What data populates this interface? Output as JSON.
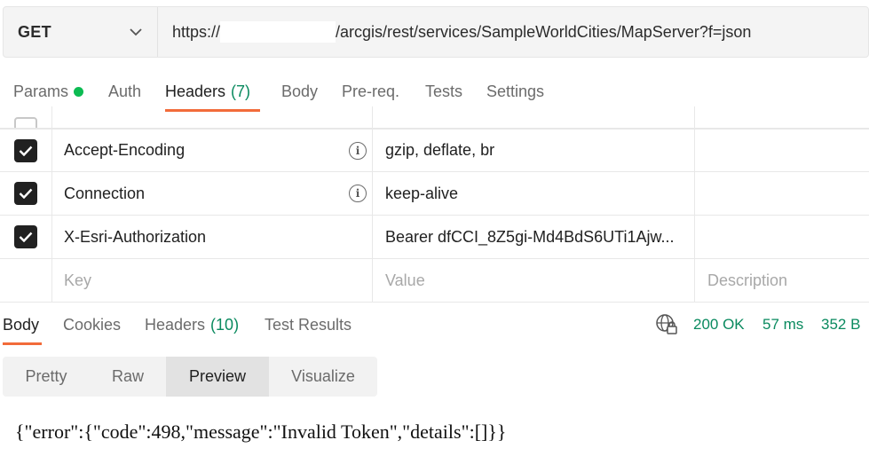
{
  "request": {
    "method": "GET",
    "url_prefix": "https://",
    "url_suffix": "/arcgis/rest/services/SampleWorldCities/MapServer?f=json"
  },
  "request_tabs": [
    {
      "label": "Params",
      "indicator": "green-dot"
    },
    {
      "label": "Auth"
    },
    {
      "label": "Headers",
      "count": "(7)",
      "active": true
    },
    {
      "label": "Body"
    },
    {
      "label": "Pre-req."
    },
    {
      "label": "Tests"
    },
    {
      "label": "Settings"
    }
  ],
  "headers": {
    "rows": [
      {
        "key": "Accept-Encoding",
        "value": "gzip, deflate, br",
        "checked": true,
        "info": true
      },
      {
        "key": "Connection",
        "value": "keep-alive",
        "checked": true,
        "info": true
      },
      {
        "key": "X-Esri-Authorization",
        "value": "Bearer dfCCI_8Z5gi-Md4BdS6UTi1Ajw...",
        "checked": true,
        "info": false
      }
    ],
    "new_row": {
      "key_placeholder": "Key",
      "value_placeholder": "Value",
      "description_placeholder": "Description"
    }
  },
  "response_tabs": [
    {
      "label": "Body",
      "active": true
    },
    {
      "label": "Cookies"
    },
    {
      "label": "Headers",
      "count": "(10)"
    },
    {
      "label": "Test Results"
    }
  ],
  "response_status": {
    "status": "200 OK",
    "time": "57 ms",
    "size": "352 B",
    "color": "#0a8a5f"
  },
  "view_modes": [
    {
      "label": "Pretty"
    },
    {
      "label": "Raw"
    },
    {
      "label": "Preview",
      "active": true
    },
    {
      "label": "Visualize"
    }
  ],
  "response_body": "{\"error\":{\"code\":498,\"message\":\"Invalid Token\",\"details\":[]}}",
  "colors": {
    "accent": "#f26b3a",
    "success": "#0a8a5f",
    "params_dot": "#0cbb52"
  },
  "icons": {
    "method_dropdown": "chevron-down-icon",
    "header_info": "info-icon",
    "network": "globe-lock-icon"
  }
}
